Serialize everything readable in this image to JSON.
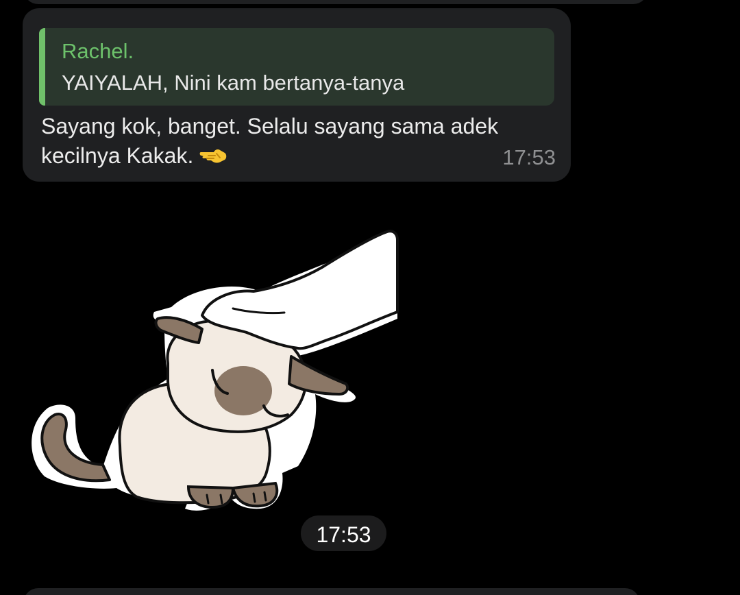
{
  "message": {
    "reply": {
      "author": "Rachel.",
      "text": "YAIYALAH, Nini kam bertanya-tanya"
    },
    "lines": [
      "Sayang kok, banget. Selalu sayang sama adek",
      "kecilnya Kakak."
    ],
    "emoji": "backhand-index-pointing-left",
    "time": "17:53"
  },
  "sticker": {
    "description_icon": "cat-being-petted-sticker",
    "time": "17:53"
  },
  "colors": {
    "background": "#000000",
    "bubble": "#1f2022",
    "quote_background": "#2a372d",
    "quote_accent": "#70c06a",
    "time_text": "#8f9092"
  }
}
